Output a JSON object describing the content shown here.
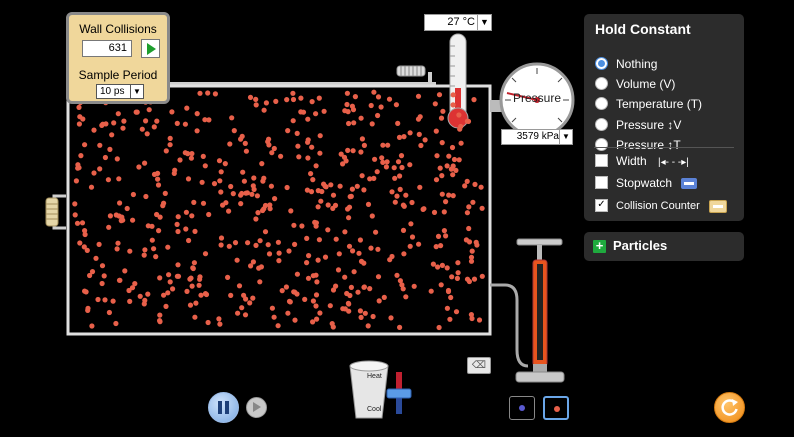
{
  "collision_counter": {
    "title": "Wall Collisions",
    "count": "631",
    "sample_period_label": "Sample Period",
    "sample_period_value": "10 ps"
  },
  "thermometer": {
    "readout": "27 °C"
  },
  "pressure_gauge": {
    "label": "Pressure",
    "readout": "3579 kPa"
  },
  "hold_constant": {
    "title": "Hold Constant",
    "options": [
      {
        "label": "Nothing",
        "selected": true
      },
      {
        "label": "Volume (V)",
        "selected": false
      },
      {
        "label": "Temperature (T)",
        "selected": false
      },
      {
        "label": "Pressure ↕V",
        "selected": false
      },
      {
        "label": "Pressure ↕T",
        "selected": false
      }
    ]
  },
  "tools": {
    "width_label": "Width",
    "width_checked": false,
    "stopwatch_label": "Stopwatch",
    "stopwatch_checked": false,
    "collision_counter_label": "Collision Counter",
    "collision_counter_checked": true
  },
  "particles_panel": {
    "label": "Particles"
  },
  "heater": {
    "heat_label": "Heat",
    "cool_label": "Cool"
  },
  "colors": {
    "particle": "#e8604a",
    "panel_bg": "#2c2c2c",
    "counter_bg": "#f0d79b",
    "accent_blue": "#4d8fe0",
    "pump_orange": "#e8541e"
  },
  "icons": {
    "play": "play-icon",
    "pause": "pause-icon",
    "step": "step-icon",
    "reset": "reset-icon",
    "eraser": "eraser-icon",
    "plus": "plus-icon"
  }
}
